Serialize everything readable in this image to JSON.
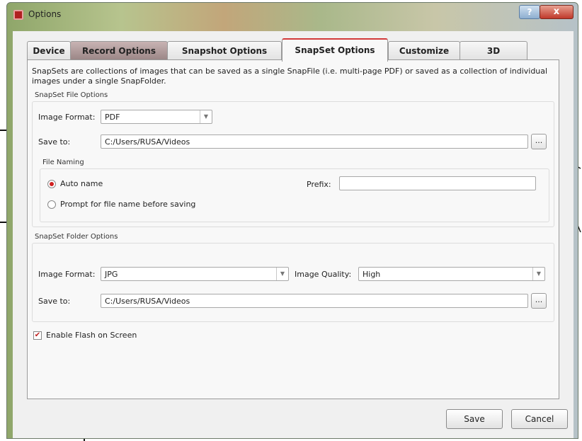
{
  "window": {
    "title": "Options",
    "help_glyph": "?",
    "close_glyph": "x"
  },
  "tabs": [
    {
      "label": "Device"
    },
    {
      "label": "Record Options"
    },
    {
      "label": "Snapshot Options"
    },
    {
      "label": "SnapSet Options"
    },
    {
      "label": "Customize"
    },
    {
      "label": "3D"
    }
  ],
  "active_tab": "SnapSet Options",
  "description": "SnapSets are collections of images that can be saved as a single SnapFile (i.e. multi-page PDF) or saved as a collection of individual images under a single SnapFolder.",
  "file_options": {
    "group_label": "SnapSet File Options",
    "image_format_label": "Image Format:",
    "image_format_value": "PDF",
    "save_to_label": "Save to:",
    "save_to_value": "C:/Users/RUSA/Videos",
    "browse_label": "...",
    "naming": {
      "group_label": "File Naming",
      "auto_name_label": "Auto name",
      "prompt_label": "Prompt for file name before saving",
      "prefix_label": "Prefix:",
      "prefix_value": "",
      "selected": "auto"
    }
  },
  "folder_options": {
    "group_label": "SnapSet Folder Options",
    "image_format_label": "Image Format:",
    "image_format_value": "JPG",
    "image_quality_label": "Image Quality:",
    "image_quality_value": "High",
    "save_to_label": "Save to:",
    "save_to_value": "C:/Users/RUSA/Videos",
    "browse_label": "..."
  },
  "flash": {
    "label": "Enable Flash on Screen",
    "checked": true
  },
  "buttons": {
    "save": "Save",
    "cancel": "Cancel"
  },
  "colors": {
    "accent": "#d23a3a",
    "panel": "#f8f8f8"
  }
}
